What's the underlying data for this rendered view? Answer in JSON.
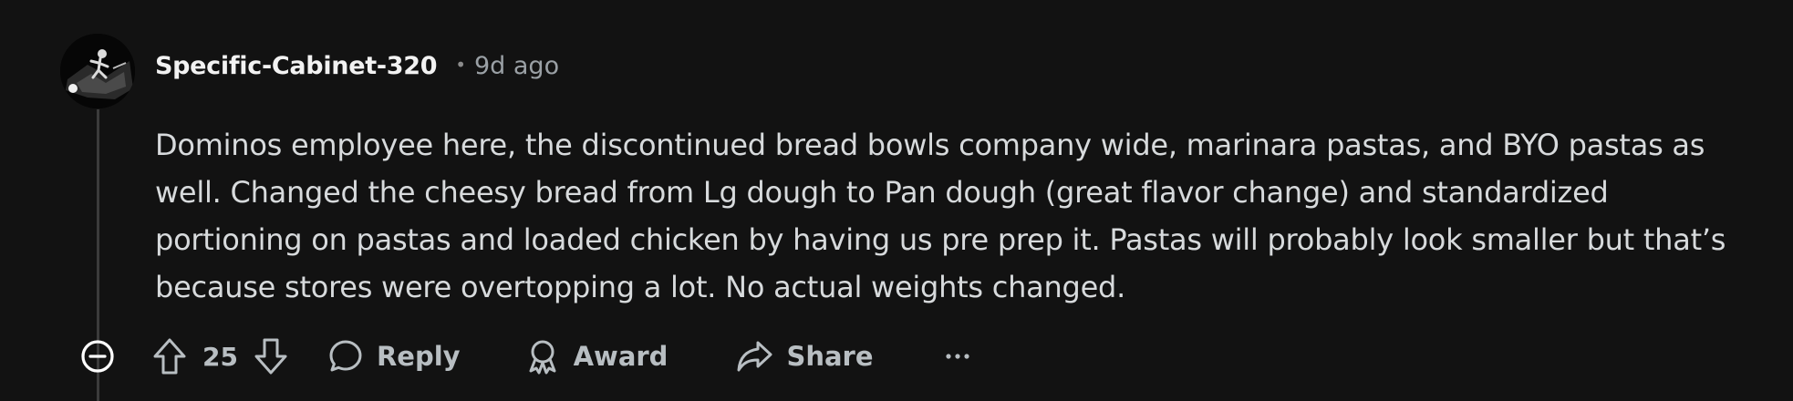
{
  "comment": {
    "author": "Specific-Cabinet-320",
    "separator": "•",
    "timestamp": "9d ago",
    "body": "Dominos employee here, the discontinued bread bowls company wide, marinara pastas, and BYO pastas as well. Changed the cheesy bread from Lg dough to Pan dough (great flavor change) and standardized portioning on pastas and loaded chicken by having us pre prep it. Pastas will probably look smaller but that’s because stores were overtopping a lot. No actual weights changed."
  },
  "actions": {
    "score": "25",
    "reply_label": "Reply",
    "award_label": "Award",
    "share_label": "Share"
  },
  "icons": {
    "collapse": "minus-circle-icon",
    "upvote": "arrow-up-icon",
    "downvote": "arrow-down-icon",
    "reply": "speech-bubble-icon",
    "award": "award-ribbon-icon",
    "share": "share-arrow-icon",
    "more": "ellipsis-icon"
  },
  "colors": {
    "background": "#121212",
    "text": "#d7dadc",
    "muted": "#b8bec2",
    "thread_line": "#3b3b3b"
  }
}
